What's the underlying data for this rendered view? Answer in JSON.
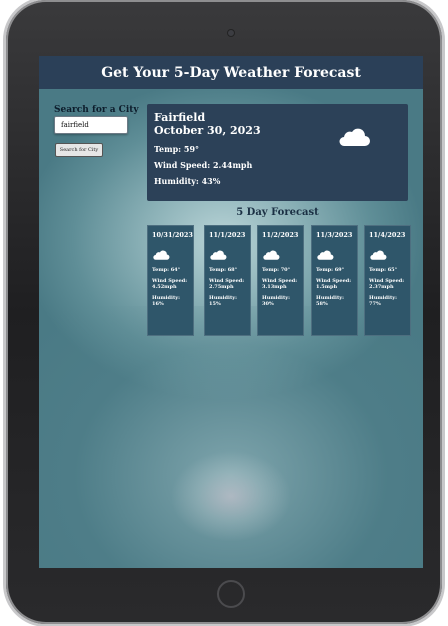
{
  "header": {
    "title": "Get Your 5-Day Weather Forecast"
  },
  "search": {
    "label": "Search for a City",
    "value": "fairfield",
    "button": "Search for City"
  },
  "current": {
    "city": "Fairfield",
    "date": "October 30, 2023",
    "temp": "Temp: 59°",
    "wind": "Wind Speed: 2.44mph",
    "humidity": "Humidity: 43%",
    "icon": "cloud-icon"
  },
  "forecast": {
    "title": "5 Day Forecast",
    "days": [
      {
        "date": "10/31/2023",
        "temp": "Temp: 64°",
        "wind_label": "Wind Speed:",
        "wind_value": "4.52mph",
        "humidity_label": "Humidity:",
        "humidity_value": "16%",
        "icon": "cloud-icon"
      },
      {
        "date": "11/1/2023",
        "temp": "Temp: 68°",
        "wind_label": "Wind Speed:",
        "wind_value": "2.75mph",
        "humidity_label": "Humidity:",
        "humidity_value": "15%",
        "icon": "cloud-icon"
      },
      {
        "date": "11/2/2023",
        "temp": "Temp: 70°",
        "wind_label": "Wind Speed:",
        "wind_value": "3.13mph",
        "humidity_label": "Humidity:",
        "humidity_value": "30%",
        "icon": "cloud-icon"
      },
      {
        "date": "11/3/2023",
        "temp": "Temp: 69°",
        "wind_label": "Wind Speed:",
        "wind_value": "1.5mph",
        "humidity_label": "Humidity:",
        "humidity_value": "58%",
        "icon": "cloud-icon"
      },
      {
        "date": "11/4/2023",
        "temp": "Temp: 65°",
        "wind_label": "Wind Speed:",
        "wind_value": "2.37mph",
        "humidity_label": "Humidity:",
        "humidity_value": "77%",
        "icon": "cloud-icon"
      }
    ]
  },
  "colors": {
    "header_bg": "#2b4058",
    "card_bg": "#2f566a",
    "current_bg": "#2c4158"
  }
}
